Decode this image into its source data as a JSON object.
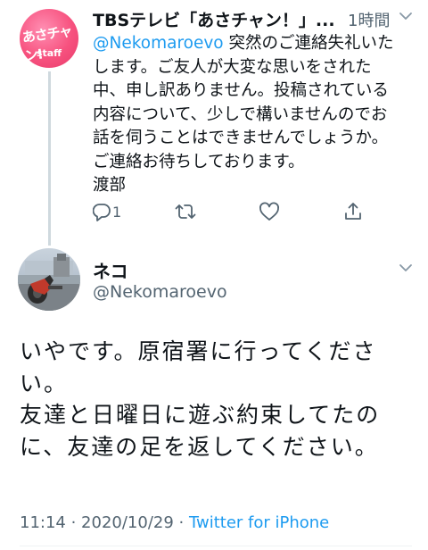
{
  "reply_tweet": {
    "display_name": "TBSテレビ「あさチャン！」...",
    "timestamp": "1時間",
    "avatar": {
      "logo_text": "あさチャン!",
      "logo_sub": "staff"
    },
    "mention": "@Nekomaroevo",
    "text": " 突然のご連絡失礼いたします。ご友人が大変な思いをされた中、申し訳ありません。投稿されている内容について、少しで構いませんのでお話を伺うことはできませんでしょうか。ご連絡お待ちしております。",
    "signature": "渡部",
    "reply_count": "1",
    "icons": [
      "reply-icon",
      "retweet-icon",
      "like-icon",
      "share-icon",
      "chevron-down-icon"
    ]
  },
  "main_tweet": {
    "display_name": "ネコ",
    "handle": "@Nekomaroevo",
    "line1": "いやです。原宿署に行ってください。",
    "line2": "友達と日曜日に遊ぶ約束してたのに、友達の足を返してください。",
    "time": "11:14",
    "sep1": " · ",
    "date": "2020/10/29",
    "sep2": " · ",
    "source": "Twitter for iPhone"
  },
  "colors": {
    "text": "#0f1419",
    "secondary": "#536471",
    "link": "#1d9bf0",
    "avatar_pink": "#f7527f",
    "thread_line": "#cfd9de"
  }
}
